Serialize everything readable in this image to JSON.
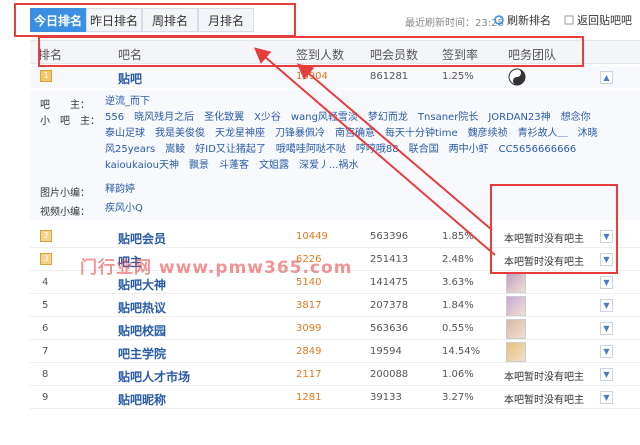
{
  "tabs": [
    {
      "label": "今日排名",
      "active": true
    },
    {
      "label": "昨日排名",
      "active": false
    },
    {
      "label": "周排名",
      "active": false
    },
    {
      "label": "月排名",
      "active": false
    }
  ],
  "refresh": {
    "info": "最近刷新时间：23:28",
    "button_label": "刷新排名",
    "back_label": "返回贴吧吧"
  },
  "columns": {
    "rank": "排名",
    "name": "吧名",
    "signin": "签到人数",
    "members": "吧会员数",
    "rate": "签到率",
    "team": "吧务团队"
  },
  "featured": {
    "rank": "1",
    "name": "贴吧",
    "signin": "10904",
    "members": "861281",
    "rate": "1.25%",
    "owner_label": "吧　　主：",
    "owner": "逆流_而下",
    "assistants_label": "小　吧　主：",
    "assistants": "556　晓风残月之后　圣化致翼　X少谷　wang风轻雪淡　梦幻而龙　Tnsaner院长　JORDAN23神　想念你　泰山足球　我是美俊俊　天龙星神座　刀锋暴佩冷　南宫确意　每天十分钟time　魏彦续祯　青衫故人＿　沐晓风25years　嵩鲮　好ID又让猪起了　哦噶哇阿哒不哒　哼哼哦88　联合国　两中小虾　CC5656666666　kaioukaiou天神　飘景　斗蓬客　文姐露　深爱丿...祸水",
    "image_editor_label": "图片小编：",
    "image_editor": "释韵婷",
    "video_editor_label": "视频小编：",
    "video_editor": "疾风小Q"
  },
  "rows": [
    {
      "rank": "2",
      "name": "贴吧会员",
      "signin": "10449",
      "members": "563396",
      "rate": "1.85%",
      "team": "本吧暂时没有吧主",
      "badge": true
    },
    {
      "rank": "3",
      "name": "吧主",
      "signin": "6226",
      "members": "251413",
      "rate": "2.48%",
      "team": "本吧暂时没有吧主",
      "badge": true
    },
    {
      "rank": "4",
      "name": "贴吧大神",
      "signin": "5140",
      "members": "141475",
      "rate": "3.63%",
      "team": "",
      "badge": false
    },
    {
      "rank": "5",
      "name": "贴吧热议",
      "signin": "3817",
      "members": "207378",
      "rate": "1.84%",
      "team": "",
      "badge": false
    },
    {
      "rank": "6",
      "name": "贴吧校园",
      "signin": "3099",
      "members": "563636",
      "rate": "0.55%",
      "team": "",
      "badge": false
    },
    {
      "rank": "7",
      "name": "吧主学院",
      "signin": "2849",
      "members": "19594",
      "rate": "14.54%",
      "team": "",
      "badge": false
    },
    {
      "rank": "8",
      "name": "贴吧人才市场",
      "signin": "2117",
      "members": "200088",
      "rate": "1.06%",
      "team": "本吧暂时没有吧主",
      "badge": false
    },
    {
      "rank": "9",
      "name": "贴吧昵称",
      "signin": "1281",
      "members": "39133",
      "rate": "3.27%",
      "team": "本吧暂时没有吧主",
      "badge": false
    }
  ],
  "watermark": "门行业网 www.pmw365.com",
  "colors": {
    "accent": "#3b8fe0",
    "annotation": "#e63d3d",
    "link": "#2a5ca8",
    "number": "#e07a1f"
  }
}
